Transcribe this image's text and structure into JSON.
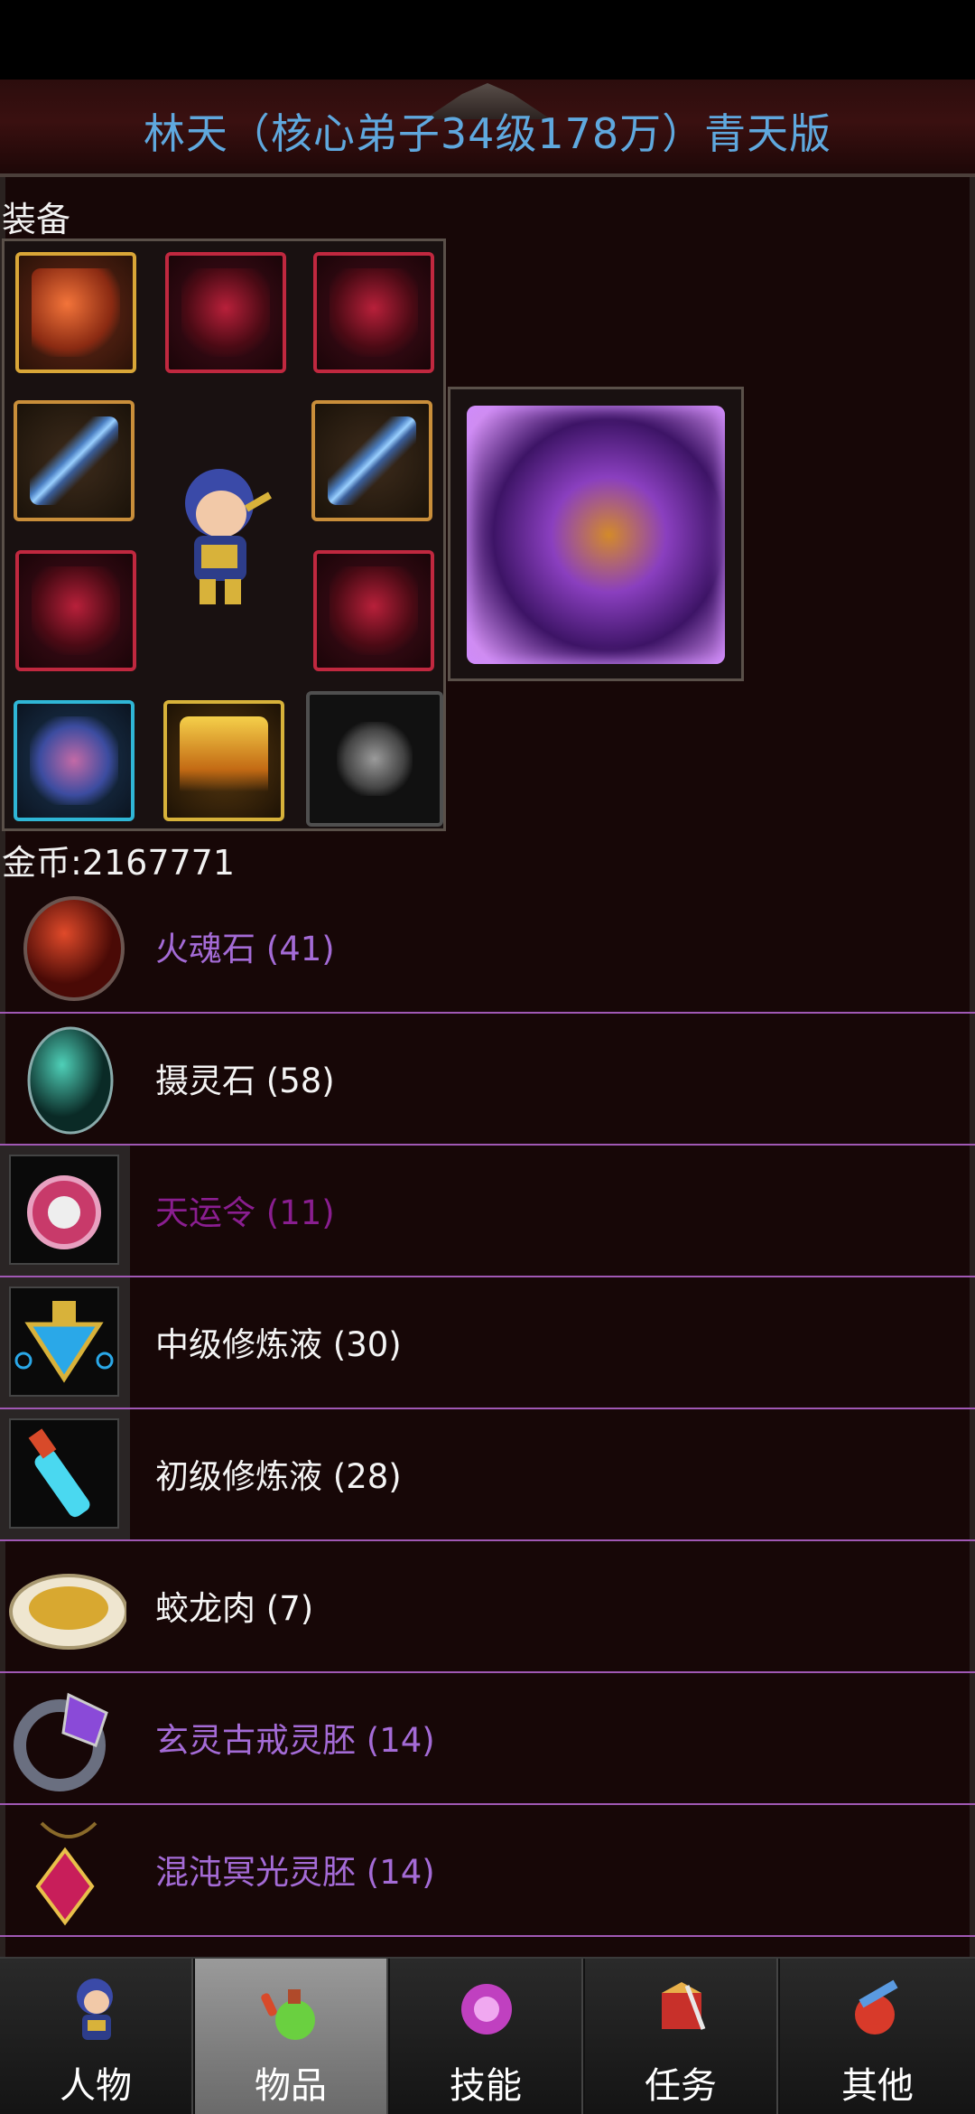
{
  "header": {
    "title": "林天（核心弟子34级178万）青天版"
  },
  "equipment": {
    "label": "装备",
    "slots": [
      {
        "name": "helmet-slot",
        "style": "gold"
      },
      {
        "name": "necklace-slot",
        "style": "red"
      },
      {
        "name": "amulet-slot",
        "style": "red"
      },
      {
        "name": "weapon-slot-left",
        "style": "blade"
      },
      {
        "name": "weapon-slot-right",
        "style": "blade"
      },
      {
        "name": "armor-slot-left",
        "style": "red"
      },
      {
        "name": "armor-slot-right",
        "style": "red"
      },
      {
        "name": "boots-slot",
        "style": "cyan"
      },
      {
        "name": "belt-slot",
        "style": "flame"
      },
      {
        "name": "beads-slot",
        "style": "dark"
      }
    ],
    "featured_item_icon": "mount-pet-icon"
  },
  "gold": {
    "text": "金币:2167771"
  },
  "inventory": [
    {
      "label": "火魂石 (41)",
      "color": "purple",
      "icon": "fire-soul-stone-icon"
    },
    {
      "label": "摄灵石 (58)",
      "color": "white",
      "icon": "spirit-stone-icon"
    },
    {
      "label": "天运令 (11)",
      "color": "magenta",
      "icon": "fortune-token-icon"
    },
    {
      "label": "中级修炼液 (30)",
      "color": "white",
      "icon": "intermediate-potion-icon"
    },
    {
      "label": "初级修炼液 (28)",
      "color": "white",
      "icon": "basic-potion-icon"
    },
    {
      "label": "蛟龙肉 (7)",
      "color": "white",
      "icon": "dragon-meat-icon"
    },
    {
      "label": "玄灵古戒灵胚 (14)",
      "color": "purple",
      "icon": "ancient-ring-icon"
    },
    {
      "label": "混沌冥光灵胚 (14)",
      "color": "purple",
      "icon": "chaos-pendant-icon"
    }
  ],
  "tabs": [
    {
      "label": "人物",
      "icon": "character-icon",
      "active": false
    },
    {
      "label": "物品",
      "icon": "items-potion-icon",
      "active": true
    },
    {
      "label": "技能",
      "icon": "skills-icon",
      "active": false
    },
    {
      "label": "任务",
      "icon": "quests-icon",
      "active": false
    },
    {
      "label": "其他",
      "icon": "other-icon",
      "active": false
    }
  ],
  "colors": {
    "title": "#5fa8de",
    "purple_text": "#a46bd6",
    "magenta_text": "#8a1e90",
    "separator": "#a058b4",
    "background": "#170707"
  }
}
